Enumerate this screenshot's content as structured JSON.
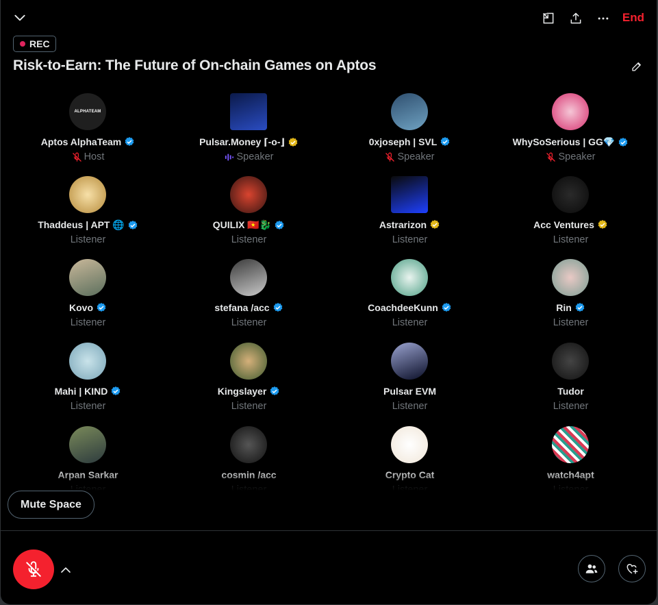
{
  "header": {
    "end_label": "End",
    "rec_label": "REC",
    "title": "Risk-to-Earn: The Future of On-chain Games on Aptos"
  },
  "participants": [
    {
      "name": "Aptos AlphaTeam",
      "role": "Host",
      "verified": "blue",
      "avatar_text": "ALPHATEAM"
    },
    {
      "name": "Pulsar.Money ⌈-o-⌋",
      "role": "Speaker",
      "verified": "gold"
    },
    {
      "name": "0xjoseph | SVL",
      "role": "Speaker",
      "verified": "blue"
    },
    {
      "name": "WhySoSerious | GG💎",
      "role": "Speaker",
      "verified": "blue"
    },
    {
      "name": "Thaddeus | APT 🌐",
      "role": "Listener",
      "verified": "blue"
    },
    {
      "name": "QUILIX 🇻🇳🐉",
      "role": "Listener",
      "verified": "blue"
    },
    {
      "name": "Astrarizon",
      "role": "Listener",
      "verified": "gold"
    },
    {
      "name": "Acc Ventures",
      "role": "Listener",
      "verified": "gold"
    },
    {
      "name": "Kovo",
      "role": "Listener",
      "verified": "blue"
    },
    {
      "name": "stefana /acc",
      "role": "Listener",
      "verified": "blue"
    },
    {
      "name": "CoachdeeKunn",
      "role": "Listener",
      "verified": "blue"
    },
    {
      "name": "Rin",
      "role": "Listener",
      "verified": "blue"
    },
    {
      "name": "Mahi | KIND",
      "role": "Listener",
      "verified": "blue"
    },
    {
      "name": "Kingslayer",
      "role": "Listener",
      "verified": "blue"
    },
    {
      "name": "Pulsar EVM",
      "role": "Listener",
      "verified": "none"
    },
    {
      "name": "Tudor",
      "role": "Listener",
      "verified": "none"
    },
    {
      "name": "Arpan Sarkar",
      "role": "Listener",
      "verified": "none"
    },
    {
      "name": "cosmin /acc",
      "role": "Listener",
      "verified": "none"
    },
    {
      "name": "Crypto Cat",
      "role": "Listener",
      "verified": "none"
    },
    {
      "name": "watch4apt",
      "role": "Listener",
      "verified": "none"
    }
  ],
  "footer": {
    "mute_space_label": "Mute Space"
  },
  "colors": {
    "accent_red": "#f4212e",
    "verified_blue": "#1d9bf0",
    "verified_gold": "#e2b719",
    "muted_text": "#71767b",
    "speaker_purple": "#7856ff"
  },
  "icons": [
    "chevron-down-icon",
    "minimize-icon",
    "share-icon",
    "more-icon",
    "edit-icon",
    "mic-muted-icon",
    "speaking-icon",
    "chevron-up-icon",
    "people-icon",
    "heart-plus-icon"
  ]
}
